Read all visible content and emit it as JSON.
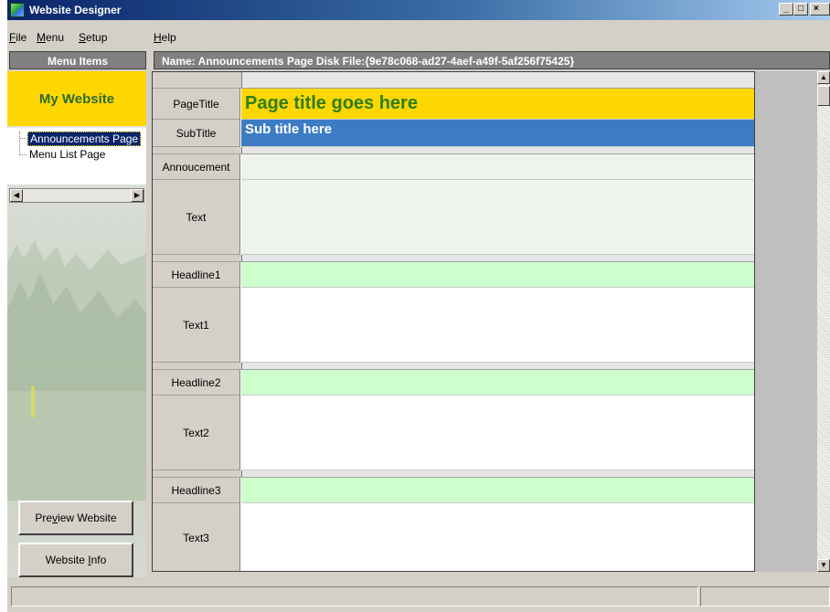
{
  "window": {
    "title": "Website Designer"
  },
  "menubar": {
    "items": [
      {
        "label": "File",
        "accel": "F",
        "rest": "ile"
      },
      {
        "label": "Menu",
        "accel": "M",
        "rest": "enu"
      },
      {
        "label": "Setup",
        "accel": "S",
        "rest": "etup"
      },
      {
        "label": "Help",
        "accel": "H",
        "rest": "elp"
      }
    ]
  },
  "left_panel": {
    "header": "Menu Items",
    "site_name": "My Website",
    "tree": [
      {
        "label": "Announcements Page",
        "selected": true
      },
      {
        "label": "Menu List Page",
        "selected": false
      }
    ],
    "buttons": {
      "preview": {
        "pre": "Pre",
        "accel": "v",
        "post": "iew Website"
      },
      "info": {
        "pre": "Website ",
        "accel": "I",
        "post": "nfo"
      }
    }
  },
  "main": {
    "header": "Name: Announcements Page    Disk File:{9e78c068-ad27-4aef-a49f-5af256f75425}",
    "rows": {
      "page_title": {
        "label": "PageTitle",
        "value": "Page title goes here"
      },
      "sub_title": {
        "label": "SubTitle",
        "value": "Sub title here"
      },
      "announcement": {
        "label": "Annoucement",
        "value": ""
      },
      "text": {
        "label": "Text",
        "value": ""
      },
      "headline1": {
        "label": "Headline1",
        "value": ""
      },
      "text1": {
        "label": "Text1",
        "value": ""
      },
      "headline2": {
        "label": "Headline2",
        "value": ""
      },
      "text2": {
        "label": "Text2",
        "value": ""
      },
      "headline3": {
        "label": "Headline3",
        "value": ""
      },
      "text3": {
        "label": "Text3",
        "value": ""
      }
    }
  },
  "colors": {
    "title_bg": "#ffd700",
    "title_text": "#2e7d1a",
    "subtitle_bg": "#3d7cc4",
    "headline_bg": "#ccffcc",
    "titlebar_start": "#0a246a"
  },
  "icons": [
    "app-icon",
    "minimize-icon",
    "maximize-icon",
    "close-icon",
    "scroll-left-icon",
    "scroll-right-icon",
    "scroll-up-icon",
    "scroll-down-icon"
  ]
}
